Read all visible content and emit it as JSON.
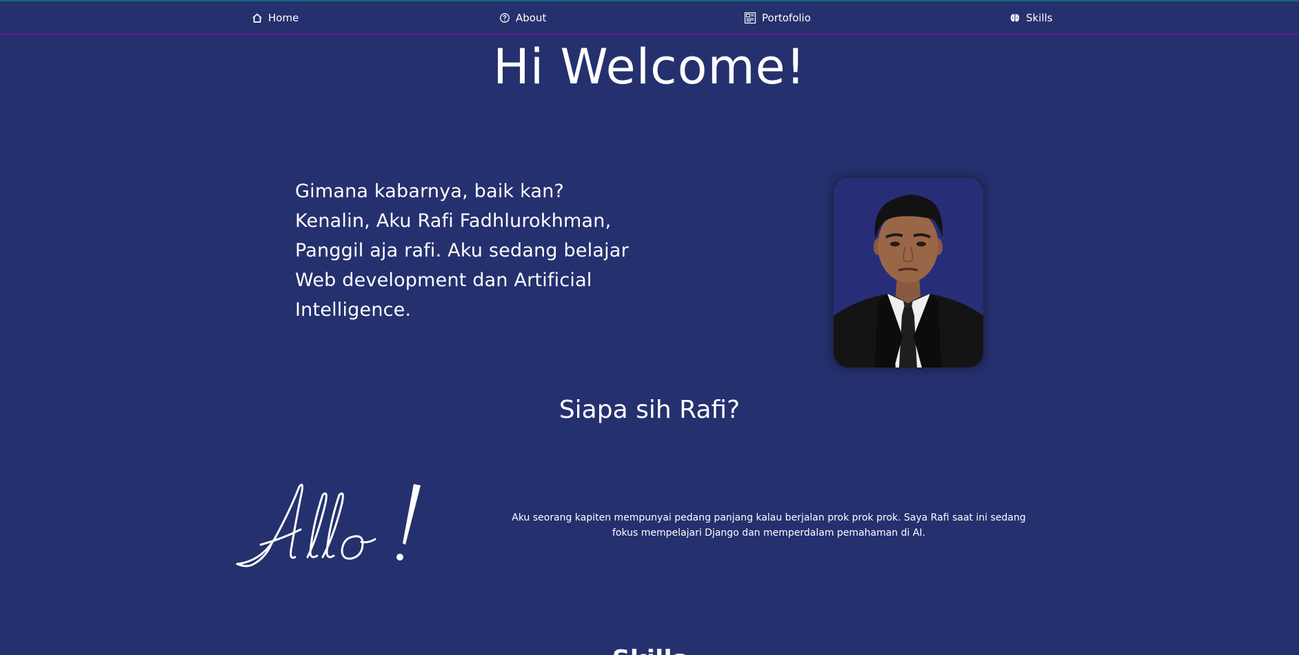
{
  "colors": {
    "background": "#25306e",
    "text": "#ffffff",
    "nav_top_border": "#0f6a78",
    "nav_bottom_border": "#5c1f86"
  },
  "nav": {
    "items": [
      {
        "label": "Home",
        "icon": "home-icon"
      },
      {
        "label": "About",
        "icon": "info-icon"
      },
      {
        "label": "Portofolio",
        "icon": "portfolio-icon"
      },
      {
        "label": "Skills",
        "icon": "skills-icon"
      }
    ]
  },
  "hero": {
    "title": "Hi Welcome!",
    "intro": "Gimana kabarnya, baik kan? Kenalin, Aku Rafi Fadhlurokhman, Panggil aja rafi. Aku sedang belajar Web development dan Artificial Intelligence."
  },
  "about": {
    "title": "Siapa sih Rafi?",
    "signature": "Allo!",
    "text": "Aku seorang kapiten mempunyai pedang panjang kalau berjalan prok prok prok. Saya Rafi saat ini sedang fokus mempelajari Django dan memperdalam pemahaman di AI."
  },
  "skills": {
    "title": "Skills"
  }
}
